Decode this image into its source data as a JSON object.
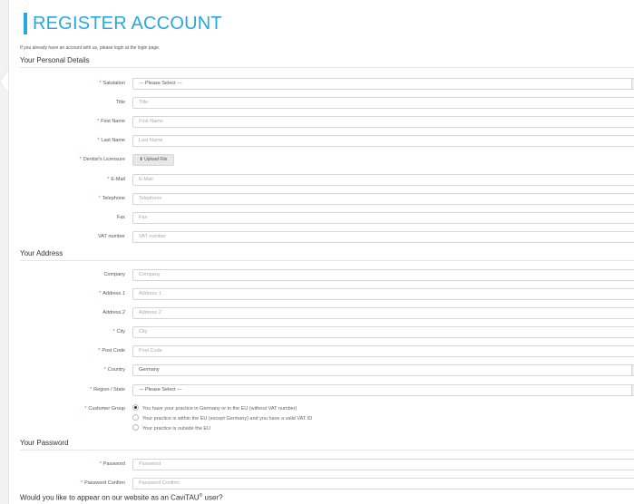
{
  "page": {
    "title": "REGISTER ACCOUNT",
    "intro": "If you already have an account with us, please login at the login page."
  },
  "personal": {
    "heading": "Your Personal Details",
    "salutation": {
      "label": "Salutation",
      "value": "--- Please Select ---"
    },
    "title": {
      "label": "Title",
      "placeholder": "Title"
    },
    "first_name": {
      "label": "First Name",
      "placeholder": "First Name"
    },
    "last_name": {
      "label": "Last Name",
      "placeholder": "Last Name"
    },
    "license": {
      "label": "Dentist's Licensure",
      "button": "Upload File"
    },
    "email": {
      "label": "E-Mail",
      "placeholder": "E-Mail"
    },
    "telephone": {
      "label": "Telephone",
      "placeholder": "Telephone"
    },
    "fax": {
      "label": "Fax",
      "placeholder": "Fax"
    },
    "vat": {
      "label": "VAT number",
      "placeholder": "VAT number"
    }
  },
  "address": {
    "heading": "Your Address",
    "company": {
      "label": "Company",
      "placeholder": "Company"
    },
    "address1": {
      "label": "Address 1",
      "placeholder": "Address 1"
    },
    "address2": {
      "label": "Address 2",
      "placeholder": "Address 2"
    },
    "city": {
      "label": "City",
      "placeholder": "City"
    },
    "postcode": {
      "label": "Post Code",
      "placeholder": "Post Code"
    },
    "country": {
      "label": "Country",
      "value": "Germany"
    },
    "region": {
      "label": "Region / State",
      "value": "--- Please Select ---"
    },
    "customer_group": {
      "label": "Customer Group",
      "options": [
        "You have your practice in Germany or in the EU (without VAT number)",
        "Your practice is within the EU (except Germany) and you have a valid VAT ID",
        "Your practice is outside the EU"
      ],
      "selected_index": 0
    }
  },
  "password": {
    "heading": "Your Password",
    "password": {
      "label": "Password",
      "placeholder": "Password"
    },
    "confirm": {
      "label": "Password Confirm",
      "placeholder": "Password Confirm"
    }
  },
  "bottom": {
    "question_prefix": "Would you like to appear on our website as an CaviTAU",
    "question_sup": "®",
    "question_suffix": " user?"
  },
  "colors": {
    "accent": "#29a8df",
    "required": "#d9534f"
  },
  "required_marker": "*"
}
